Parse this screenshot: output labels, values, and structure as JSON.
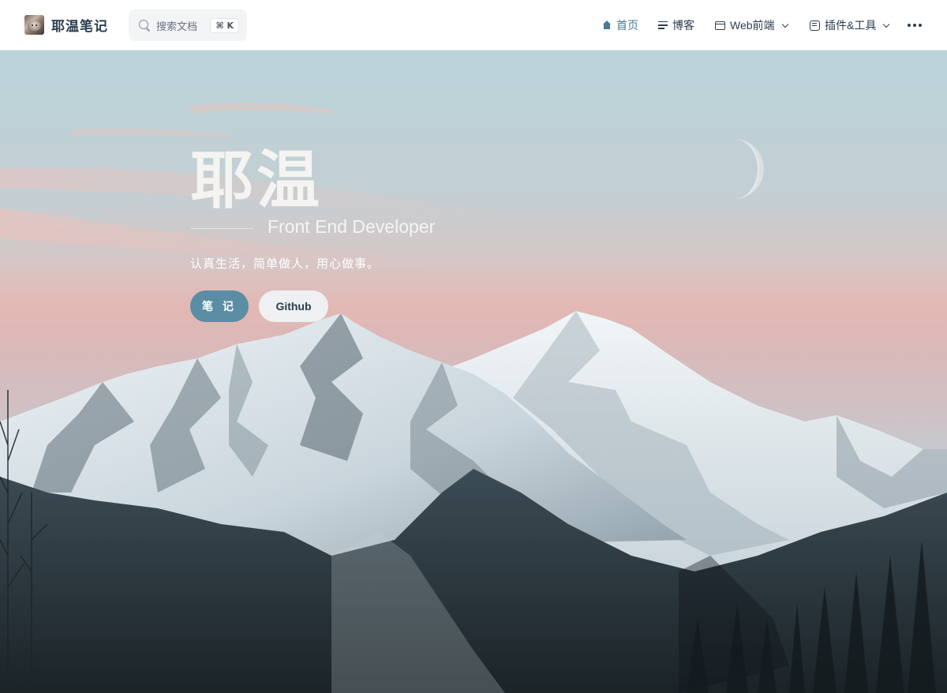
{
  "header": {
    "brand_title": "耶温笔记",
    "search": {
      "placeholder": "搜索文档",
      "shortcut": "⌘ K"
    },
    "nav": {
      "home": "首页",
      "blog": "博客",
      "web": "Web前端",
      "tools": "插件&工具"
    }
  },
  "hero": {
    "name": "耶温",
    "tagline": "Front End Developer",
    "description": "认真生活，简单做人，用心做事。",
    "actions": {
      "primary": "笔 记",
      "secondary": "Github"
    }
  },
  "colors": {
    "accent": "#5b8da4",
    "nav_active": "#4a7a94",
    "text": "#2c3e50"
  }
}
